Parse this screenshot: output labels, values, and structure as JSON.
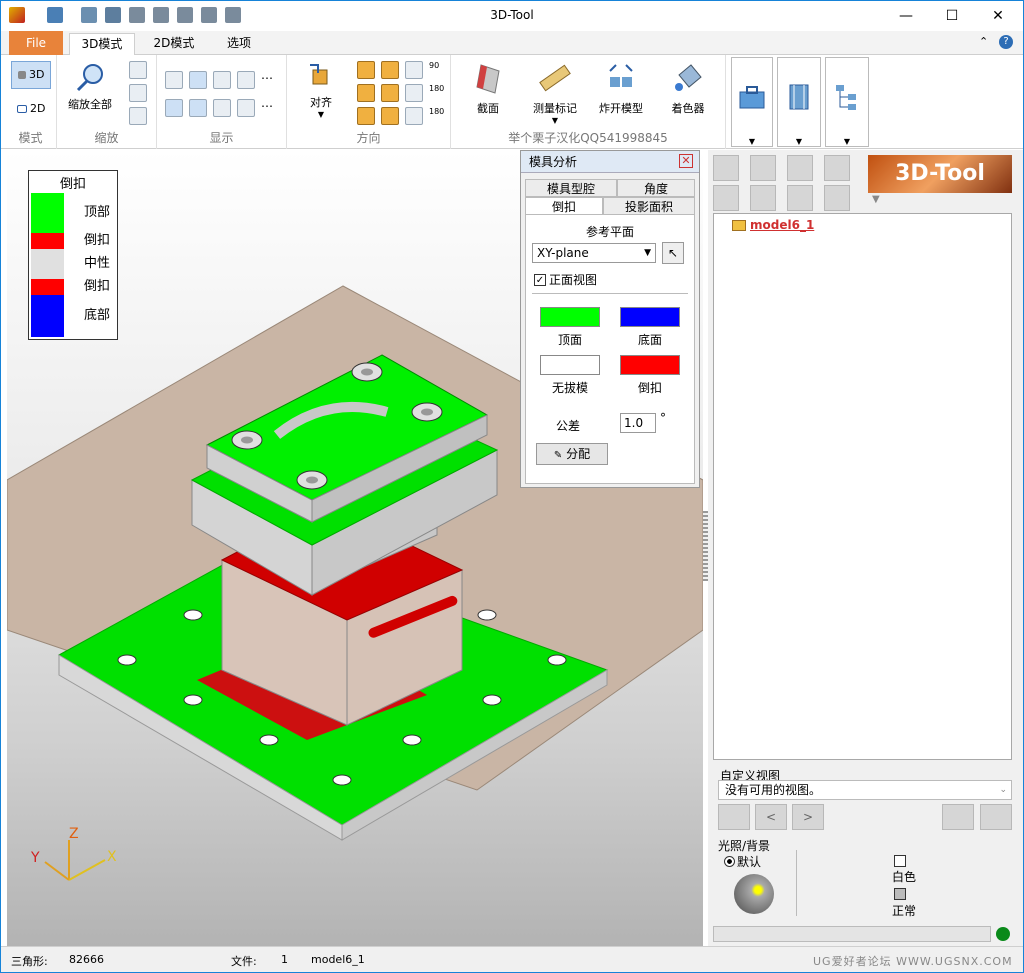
{
  "window": {
    "title": "3D-Tool"
  },
  "ribbon_tabs": [
    "File",
    "3D模式",
    "2D模式",
    "选项"
  ],
  "ribbon": {
    "mode": {
      "label": "模式",
      "btn_3d": "3D",
      "btn_2d": "2D"
    },
    "zoom": {
      "label": "缩放",
      "zoom_all": "缩放全部"
    },
    "display": {
      "label": "显示"
    },
    "direction": {
      "label": "方向",
      "align": "对齐",
      "deg90": "90",
      "deg180a": "180",
      "deg180b": "180"
    },
    "tools": {
      "section": "截面",
      "measure": "测量标记",
      "explode": "炸开模型",
      "colorize": "着色器",
      "credit": "举个栗子汉化QQ541998845"
    }
  },
  "legend": {
    "title": "倒扣",
    "items": [
      {
        "label": "顶部",
        "color": "#00ff00"
      },
      {
        "label": "倒扣",
        "color": "#ff0000"
      },
      {
        "label": "中性",
        "color": "#e0e0e0"
      },
      {
        "label": "倒扣",
        "color": "#ff0000"
      },
      {
        "label": "底部",
        "color": "#0000ff"
      }
    ]
  },
  "mold_panel": {
    "title": "模具分析",
    "tabs": {
      "cavity": "模具型腔",
      "angle": "角度",
      "undercut": "倒扣",
      "projected": "投影面积"
    },
    "ref_plane_label": "参考平面",
    "ref_plane_value": "XY-plane",
    "front_view_label": "正面视图",
    "front_view_checked": true,
    "colors": [
      {
        "label": "顶面",
        "color": "#00ff00"
      },
      {
        "label": "底面",
        "color": "#0000ff"
      },
      {
        "label": "无拔模",
        "color": "#ffffff"
      },
      {
        "label": "倒扣",
        "color": "#ff0000"
      }
    ],
    "tolerance_label": "公差",
    "tolerance_value": "1.0",
    "tolerance_unit": "°",
    "assign_button": "分配"
  },
  "right_panel": {
    "logo": "3D-Tool",
    "tree_item": "model6_1",
    "custom_view_label": "自定义视图",
    "custom_view_value": "没有可用的视图。",
    "prev": "<",
    "next": ">",
    "light_label": "光照/背景",
    "default_label": "默认",
    "white_label": "白色",
    "normal_label": "正常"
  },
  "axes": {
    "x": "X",
    "y": "Y",
    "z": "Z"
  },
  "status": {
    "tri_label": "三角形:",
    "tri_value": "82666",
    "file_label": "文件:",
    "file_count": "1",
    "file_name": "model6_1",
    "watermark": "UG爱好者论坛 WWW.UGSNX.COM"
  }
}
